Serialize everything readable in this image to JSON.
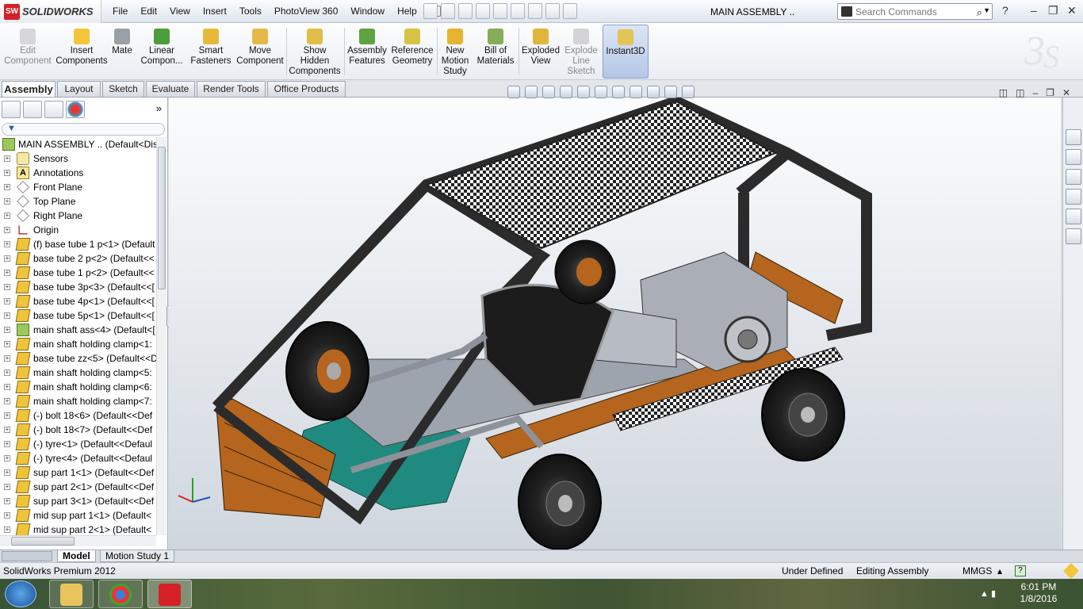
{
  "app": {
    "name": "SOLIDWORKS",
    "logo_badge": "SW",
    "document_title": "MAIN ASSEMBLY ..",
    "product": "SolidWorks Premium 2012"
  },
  "menu": [
    "File",
    "Edit",
    "View",
    "Insert",
    "Tools",
    "PhotoView 360",
    "Window",
    "Help"
  ],
  "search": {
    "placeholder": "Search Commands"
  },
  "commands": [
    {
      "label": "Edit\nComponent",
      "disabled": true
    },
    {
      "label": "Insert\nComponents",
      "disabled": false
    },
    {
      "label": "Mate",
      "disabled": false
    },
    {
      "label": "Linear\nCompon...",
      "disabled": false
    },
    {
      "label": "Smart\nFasteners",
      "disabled": false
    },
    {
      "label": "Move\nComponent",
      "disabled": false
    },
    {
      "label": "Show\nHidden\nComponents",
      "disabled": false
    },
    {
      "label": "Assembly\nFeatures",
      "disabled": false
    },
    {
      "label": "Reference\nGeometry",
      "disabled": false
    },
    {
      "label": "New\nMotion\nStudy",
      "disabled": false
    },
    {
      "label": "Bill of\nMaterials",
      "disabled": false
    },
    {
      "label": "Exploded\nView",
      "disabled": false
    },
    {
      "label": "Explode\nLine\nSketch",
      "disabled": true
    },
    {
      "label": "Instant3D",
      "disabled": false,
      "active": true
    }
  ],
  "tabs": [
    "Assembly",
    "Layout",
    "Sketch",
    "Evaluate",
    "Render Tools",
    "Office Products"
  ],
  "active_tab": "Assembly",
  "tree": {
    "root": "MAIN ASSEMBLY ..  (Default<Dis",
    "items": [
      {
        "label": "Sensors",
        "icon": "sensors-icon"
      },
      {
        "label": "Annotations",
        "icon": "annotations-icon"
      },
      {
        "label": "Front Plane",
        "icon": "plane-icon"
      },
      {
        "label": "Top Plane",
        "icon": "plane-icon"
      },
      {
        "label": "Right Plane",
        "icon": "plane-icon"
      },
      {
        "label": "Origin",
        "icon": "origin-icon"
      },
      {
        "label": "(f) base tube 1 p<1> (Default",
        "icon": "part-icon"
      },
      {
        "label": "base tube 2 p<2> (Default<<",
        "icon": "part-icon"
      },
      {
        "label": "base tube 1 p<2> (Default<<",
        "icon": "part-icon"
      },
      {
        "label": "base tube 3p<3> (Default<<[",
        "icon": "part-icon"
      },
      {
        "label": "base tube 4p<1> (Default<<[",
        "icon": "part-icon"
      },
      {
        "label": "base tube 5p<1> (Default<<[",
        "icon": "part-icon"
      },
      {
        "label": "main shaft ass<4> (Default<[",
        "icon": "assembly-icon"
      },
      {
        "label": "main shaft holding clamp<1:",
        "icon": "part-icon"
      },
      {
        "label": "base tube zz<5> (Default<<D",
        "icon": "part-icon"
      },
      {
        "label": "main shaft holding clamp<5:",
        "icon": "part-icon"
      },
      {
        "label": "main shaft holding clamp<6:",
        "icon": "part-icon"
      },
      {
        "label": "main shaft holding clamp<7:",
        "icon": "part-icon"
      },
      {
        "label": "(-) bolt 18<6> (Default<<Def",
        "icon": "part-icon"
      },
      {
        "label": "(-) bolt 18<7> (Default<<Def",
        "icon": "part-icon"
      },
      {
        "label": "(-) tyre<1> (Default<<Defaul",
        "icon": "part-icon"
      },
      {
        "label": "(-) tyre<4> (Default<<Defaul",
        "icon": "part-icon"
      },
      {
        "label": "sup part 1<1> (Default<<Def",
        "icon": "part-icon"
      },
      {
        "label": "sup part 2<1> (Default<<Def",
        "icon": "part-icon"
      },
      {
        "label": "sup part 3<1> (Default<<Def",
        "icon": "part-icon"
      },
      {
        "label": "mid sup part 1<1> (Default<",
        "icon": "part-icon"
      },
      {
        "label": "mid sup part 2<1> (Default<",
        "icon": "part-icon"
      }
    ]
  },
  "bottom_tabs": [
    "Model",
    "Motion Study 1"
  ],
  "status": {
    "state": "Under Defined",
    "mode": "Editing Assembly",
    "units": "MMGS"
  },
  "clock": {
    "time": "6:01 PM",
    "date": "1/8/2016"
  },
  "colors": {
    "accent": "#d42027",
    "wood": "#b5651d",
    "frame": "#2b2b2b",
    "teal": "#1f8a80",
    "steel": "#a9aeb7"
  }
}
